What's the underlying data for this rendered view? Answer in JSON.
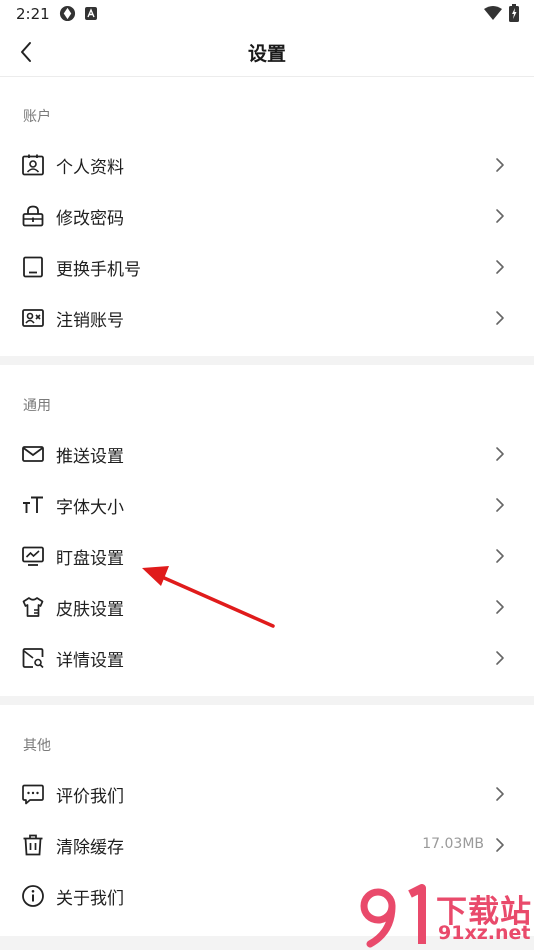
{
  "status_bar": {
    "time": "2:21"
  },
  "header": {
    "title": "设置"
  },
  "sections": [
    {
      "title": "账户",
      "items": [
        {
          "label": "个人资料",
          "icon": "profile-card-icon"
        },
        {
          "label": "修改密码",
          "icon": "lock-icon"
        },
        {
          "label": "更换手机号",
          "icon": "phone-icon"
        },
        {
          "label": "注销账号",
          "icon": "id-card-remove-icon"
        }
      ]
    },
    {
      "title": "通用",
      "items": [
        {
          "label": "推送设置",
          "icon": "mail-icon"
        },
        {
          "label": "字体大小",
          "icon": "font-size-icon"
        },
        {
          "label": "盯盘设置",
          "icon": "monitor-chart-icon"
        },
        {
          "label": "皮肤设置",
          "icon": "shirt-icon"
        },
        {
          "label": "详情设置",
          "icon": "detail-search-icon"
        }
      ]
    },
    {
      "title": "其他",
      "items": [
        {
          "label": "评价我们",
          "icon": "chat-bubble-icon"
        },
        {
          "label": "清除缓存",
          "icon": "trash-icon",
          "value": "17.03MB"
        },
        {
          "label": "关于我们",
          "icon": "info-icon"
        }
      ]
    }
  ],
  "watermark": {
    "title": "下载站",
    "url": "91xz.net"
  },
  "colors": {
    "annotation": "#e01b1b",
    "watermark": "#e94a6b",
    "separator": "#f3f3f3"
  }
}
